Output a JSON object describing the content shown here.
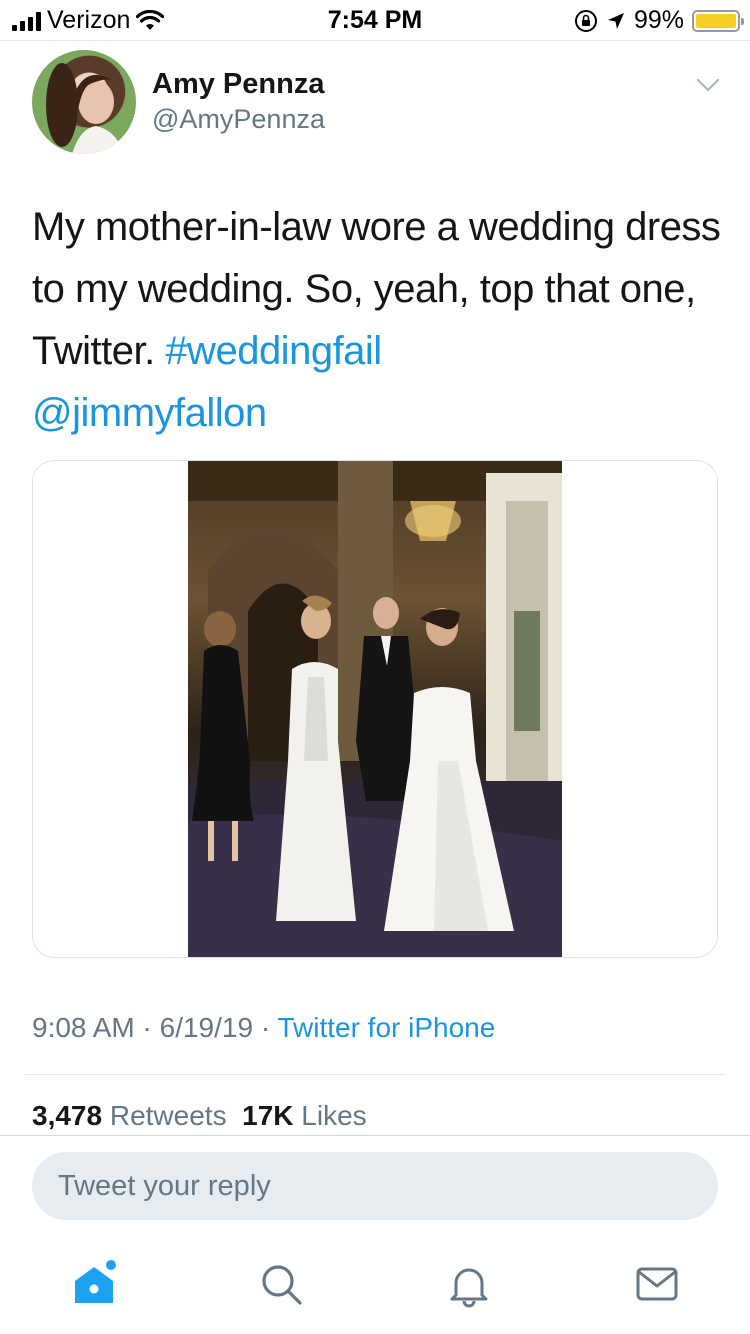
{
  "status_bar": {
    "carrier": "Verizon",
    "time": "7:54 PM",
    "battery": "99%",
    "battery_level": 0.99
  },
  "tweet": {
    "author_name": "Amy Pennza",
    "author_handle": "@AmyPennza",
    "text_1": "My mother-in-law wore a wedding dress to my wedding. So, yeah, top that one, Twitter. ",
    "hashtag": "#weddingfail",
    "mention": "@jimmyfallon",
    "time": "9:08 AM",
    "date": "6/19/19",
    "source": "Twitter for iPhone",
    "retweets_count": "3,478",
    "retweets_label": "Retweets",
    "likes_count": "17K",
    "likes_label": "Likes"
  },
  "reply": {
    "placeholder": "Tweet your reply"
  },
  "tab_bar": {
    "items": [
      "home-icon",
      "search-icon",
      "notifications-icon",
      "messages-icon"
    ],
    "active": "home-icon"
  },
  "colors": {
    "link": "#1b95e0",
    "secondary": "#657786",
    "reply_bg": "#e6ecf0",
    "battery": "#f5d020"
  }
}
